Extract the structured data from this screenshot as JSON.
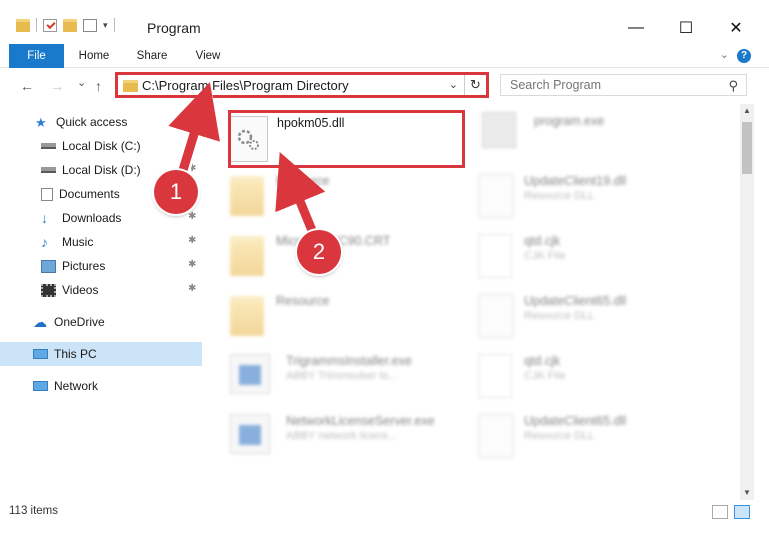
{
  "window": {
    "title": "Program",
    "minimize": "—",
    "maximize": "☐",
    "close": "✕"
  },
  "ribbon": {
    "tabs": [
      "File",
      "Home",
      "Share",
      "View"
    ],
    "help": "?"
  },
  "nav": {
    "back": "←",
    "forward": "→",
    "recent": "⌄",
    "up": "↑",
    "address": "C:\\Program Files\\Program Directory",
    "refresh": "↻",
    "search_placeholder": "Search Program"
  },
  "sidebar": {
    "items": [
      {
        "label": "Quick access",
        "icon": "star-icon",
        "pinned": false
      },
      {
        "label": "Local Disk (C:)",
        "icon": "drive-icon",
        "pinned": true
      },
      {
        "label": "Local Disk (D:)",
        "icon": "drive-icon",
        "pinned": true
      },
      {
        "label": "Documents",
        "icon": "documents-icon",
        "pinned": true
      },
      {
        "label": "Downloads",
        "icon": "downloads-icon",
        "pinned": true
      },
      {
        "label": "Music",
        "icon": "music-icon",
        "pinned": true
      },
      {
        "label": "Pictures",
        "icon": "pictures-icon",
        "pinned": true
      },
      {
        "label": "Videos",
        "icon": "videos-icon",
        "pinned": true
      },
      {
        "label": "OneDrive",
        "icon": "cloud-icon",
        "pinned": false
      },
      {
        "label": "This PC",
        "icon": "computer-icon",
        "pinned": false,
        "selected": true
      },
      {
        "label": "Network",
        "icon": "network-icon",
        "pinned": false
      }
    ]
  },
  "files": [
    {
      "name": "hpokm05.dll",
      "type": "",
      "icon": "dll-gear-icon",
      "highlighted": true
    },
    {
      "name": "program.exe",
      "type": "",
      "icon": "exe-icon"
    },
    {
      "name": "Resource",
      "type": "",
      "icon": "folder-icon"
    },
    {
      "name": "UpdateClient19.dll",
      "type": "Resource DLL",
      "icon": "dll-gear-icon"
    },
    {
      "name": "Microsoft.VC90.CRT",
      "type": "",
      "icon": "folder-icon"
    },
    {
      "name": "qtd.cjk",
      "type": "CJK File",
      "icon": "document-icon"
    },
    {
      "name": "Resource",
      "type": "",
      "icon": "folder-icon"
    },
    {
      "name": "UpdateClient65.dll",
      "type": "Resource DLL",
      "icon": "dll-gear-icon"
    },
    {
      "name": "TrigrammsInstaller.exe",
      "type": "ABBY Trimmsuber to...",
      "icon": "exe-icon"
    },
    {
      "name": "qtd.cjk",
      "type": "CJK File",
      "icon": "document-icon"
    },
    {
      "name": "NetworkLicenseServer.exe",
      "type": "ABBY network licens...",
      "icon": "exe-icon"
    },
    {
      "name": "UpdateClient65.dll",
      "type": "Resource DLL",
      "icon": "dll-gear-icon"
    }
  ],
  "status": {
    "item_count": "113 items"
  },
  "callouts": [
    "1",
    "2"
  ],
  "colors": {
    "accent": "#1979ca",
    "highlight": "#d9363e",
    "selection": "#cce4f7"
  }
}
